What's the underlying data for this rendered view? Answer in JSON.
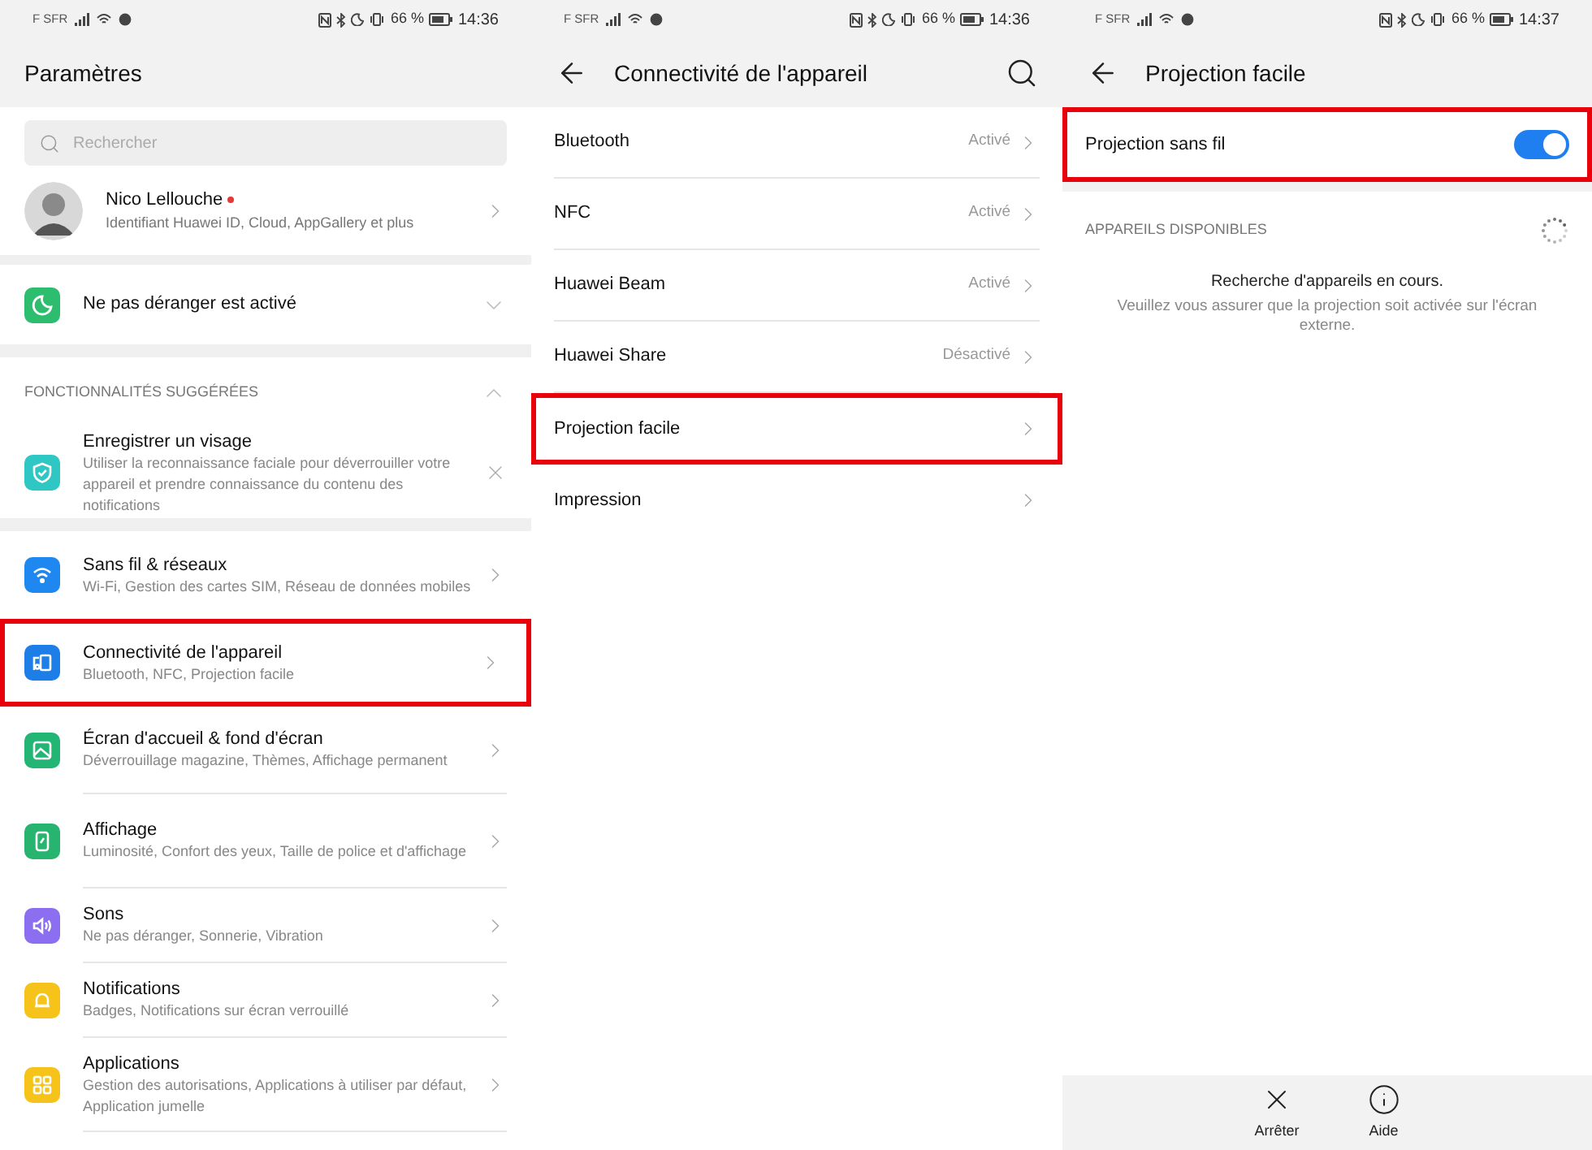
{
  "screens": [
    {
      "status_bar": {
        "carrier": "F SFR",
        "battery": "66 %",
        "time": "14:36"
      },
      "header": {
        "title": "Paramètres"
      },
      "search": {
        "placeholder": "Rechercher"
      },
      "account": {
        "name": "Nico Lellouche",
        "subtitle": "Identifiant Huawei ID, Cloud, AppGallery et plus",
        "notification_dot": true
      },
      "dnd_banner": {
        "label": "Ne pas déranger est activé",
        "color": "#2dbd6e",
        "expanded": false
      },
      "suggestions": {
        "heading": "FONCTIONNALITÉS SUGGÉRÉES",
        "expanded": true,
        "items": [
          {
            "title": "Enregistrer un visage",
            "subtitle": "Utiliser la reconnaissance faciale pour déverrouiller votre appareil et prendre connaissance du contenu des notifications",
            "color": "#2ec7c3"
          }
        ]
      },
      "menu": [
        {
          "title": "Sans fil & réseaux",
          "subtitle": "Wi-Fi, Gestion des cartes SIM, Réseau de données mobiles",
          "color": "#1e88f0",
          "highlighted": false
        },
        {
          "title": "Connectivité de l'appareil",
          "subtitle": "Bluetooth, NFC, Projection facile",
          "color": "#1c7ee6",
          "highlighted": true
        },
        {
          "title": "Écran d'accueil & fond d'écran",
          "subtitle": "Déverrouillage magazine, Thèmes, Affichage permanent",
          "color": "#22b573",
          "highlighted": false
        },
        {
          "title": "Affichage",
          "subtitle": "Luminosité, Confort des yeux, Taille de police et d'affichage",
          "color": "#27b46e",
          "highlighted": false
        },
        {
          "title": "Sons",
          "subtitle": "Ne pas déranger, Sonnerie, Vibration",
          "color": "#8c6ff0",
          "highlighted": false
        },
        {
          "title": "Notifications",
          "subtitle": "Badges, Notifications sur écran verrouillé",
          "color": "#f6c31a",
          "highlighted": false
        },
        {
          "title": "Applications",
          "subtitle": "Gestion des autorisations, Applications à utiliser par défaut, Application jumelle",
          "color": "#f6c31a",
          "highlighted": false
        }
      ]
    },
    {
      "status_bar": {
        "carrier": "F SFR",
        "battery": "66 %",
        "time": "14:36"
      },
      "header": {
        "title": "Connectivité de l'appareil"
      },
      "menu": [
        {
          "title": "Bluetooth",
          "value": "Activé",
          "highlighted": false
        },
        {
          "title": "NFC",
          "value": "Activé",
          "highlighted": false
        },
        {
          "title": "Huawei Beam",
          "value": "Activé",
          "highlighted": false
        },
        {
          "title": "Huawei Share",
          "value": "Désactivé",
          "highlighted": false
        },
        {
          "title": "Projection facile",
          "highlighted": true
        },
        {
          "title": "Impression",
          "highlighted": false
        }
      ]
    },
    {
      "status_bar": {
        "carrier": "F SFR",
        "battery": "66 %",
        "time": "14:37"
      },
      "header": {
        "title": "Projection facile"
      },
      "toggle": {
        "label": "Projection sans fil",
        "on": true,
        "highlighted": true
      },
      "devices": {
        "heading": "APPAREILS DISPONIBLES",
        "message": "Recherche d'appareils en cours.",
        "hint": "Veuillez vous assurer que la projection soit activée sur l'écran externe."
      },
      "bottom_bar": [
        {
          "kind": "stop",
          "label": "Arrêter"
        },
        {
          "kind": "help",
          "label": "Aide"
        }
      ]
    }
  ]
}
